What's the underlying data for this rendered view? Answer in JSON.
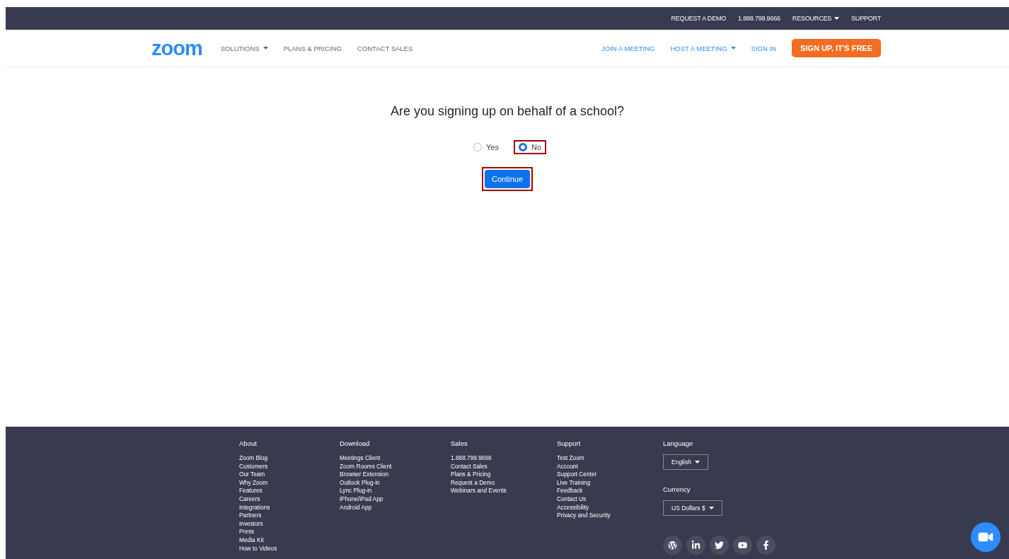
{
  "top_bar": {
    "links": [
      {
        "label": "REQUEST A DEMO",
        "dropdown": false
      },
      {
        "label": "1.888.799.9666",
        "dropdown": false
      },
      {
        "label": "RESOURCES",
        "dropdown": true
      },
      {
        "label": "SUPPORT",
        "dropdown": false
      }
    ]
  },
  "nav": {
    "logo": "zoom",
    "left_links": [
      {
        "label": "SOLUTIONS",
        "dropdown": true
      },
      {
        "label": "PLANS & PRICING",
        "dropdown": false
      },
      {
        "label": "CONTACT SALES",
        "dropdown": false
      }
    ],
    "right_links": [
      {
        "label": "JOIN A MEETING",
        "dropdown": false
      },
      {
        "label": "HOST A MEETING",
        "dropdown": true
      },
      {
        "label": "SIGN IN",
        "dropdown": false
      }
    ],
    "cta": "SIGN UP, IT'S FREE"
  },
  "question": {
    "title": "Are you signing up on behalf of a school?",
    "options": [
      {
        "label": "Yes",
        "selected": false,
        "highlighted": false
      },
      {
        "label": "No",
        "selected": true,
        "highlighted": true
      }
    ],
    "button": {
      "label": "Continue",
      "highlighted": true
    }
  },
  "footer": {
    "columns": [
      {
        "heading": "About",
        "links": [
          "Zoom Blog",
          "Customers",
          "Our Team",
          "Why Zoom",
          "Features",
          "Careers",
          "Integrations",
          "Partners",
          "Investors",
          "Press",
          "Media Kit",
          "How to Videos"
        ]
      },
      {
        "heading": "Download",
        "links": [
          "Meetings Client",
          "Zoom Rooms Client",
          "Browser Extension",
          "Outlook Plug-in",
          "Lync Plug-in",
          "iPhone/iPad App",
          "Android App"
        ]
      },
      {
        "heading": "Sales",
        "links": [
          "1.888.799.9666",
          "Contact Sales",
          "Plans & Pricing",
          "Request a Demo",
          "Webinars and Events"
        ]
      },
      {
        "heading": "Support",
        "links": [
          "Test Zoom",
          "Account",
          "Support Center",
          "Live Training",
          "Feedback",
          "Contact Us",
          "Accessibility",
          "Privacy and Security"
        ]
      }
    ],
    "language": {
      "heading": "Language",
      "value": "English"
    },
    "currency": {
      "heading": "Currency",
      "value": "US Dollars $"
    },
    "social": [
      {
        "kind": "wordpress"
      },
      {
        "kind": "linkedin"
      },
      {
        "kind": "twitter"
      },
      {
        "kind": "youtube"
      },
      {
        "kind": "facebook"
      }
    ]
  }
}
